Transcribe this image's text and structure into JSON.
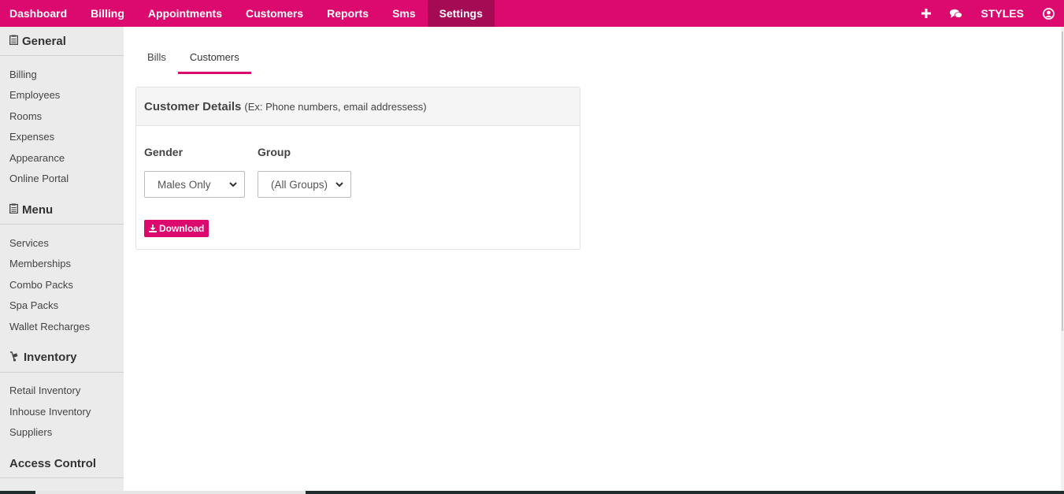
{
  "topnav": {
    "items": [
      {
        "label": "Dashboard"
      },
      {
        "label": "Billing"
      },
      {
        "label": "Appointments"
      },
      {
        "label": "Customers"
      },
      {
        "label": "Reports"
      },
      {
        "label": "Sms"
      },
      {
        "label": "Settings",
        "active": true
      }
    ],
    "styles_label": "STYLES",
    "icons": [
      "plus-icon",
      "chat-icon",
      "user-circle-icon"
    ]
  },
  "sidebar": {
    "sections": [
      {
        "title": "General",
        "icon": "clipboard-icon",
        "items": [
          "Billing",
          "Employees",
          "Rooms",
          "Expenses",
          "Appearance",
          "Online Portal"
        ]
      },
      {
        "title": "Menu",
        "icon": "clipboard-icon",
        "items": [
          "Services",
          "Memberships",
          "Combo Packs",
          "Spa Packs",
          "Wallet Recharges"
        ]
      },
      {
        "title": "Inventory",
        "icon": "dolly-icon",
        "items": [
          "Retail Inventory",
          "Inhouse Inventory",
          "Suppliers"
        ]
      },
      {
        "title": "Access Control",
        "icon": "",
        "items": []
      }
    ]
  },
  "tabs": [
    {
      "label": "Bills"
    },
    {
      "label": "Customers",
      "active": true
    }
  ],
  "panel": {
    "title": "Customer Details",
    "subtitle": "(Ex: Phone numbers, email addressess)",
    "gender_label": "Gender",
    "gender_value": "Males Only",
    "group_label": "Group",
    "group_value": "(All Groups)",
    "download_label": "Download"
  },
  "colors": {
    "brand": "#dc0a6e",
    "brand_active": "#a50a55"
  }
}
